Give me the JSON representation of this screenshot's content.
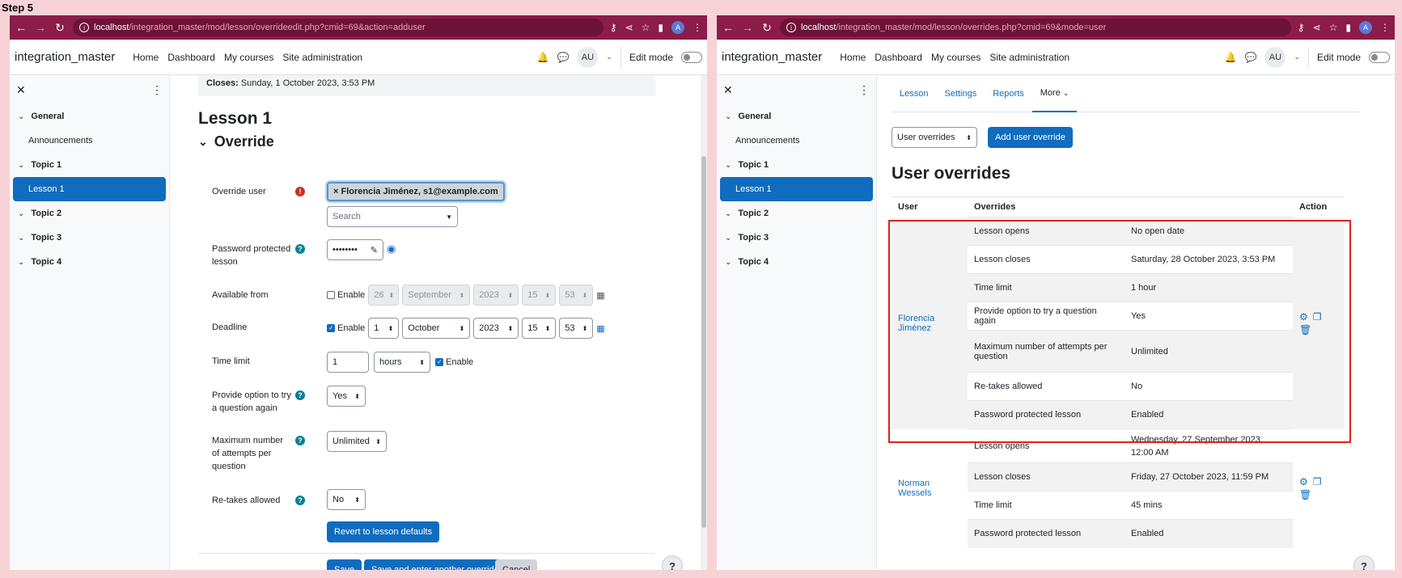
{
  "step_label": "Step 5",
  "left": {
    "url_host": "localhost",
    "url_path": "/integration_master/mod/lesson/overrideedit.php?cmid=69&action=adduser",
    "brand": "integration_master",
    "nav": [
      "Home",
      "Dashboard",
      "My courses",
      "Site administration"
    ],
    "avatar": "AU",
    "edit_mode": "Edit mode",
    "drawer": [
      {
        "label": "General",
        "type": "section"
      },
      {
        "label": "Announcements",
        "type": "sub"
      },
      {
        "label": "Topic 1",
        "type": "section"
      },
      {
        "label": "Lesson 1",
        "type": "active"
      },
      {
        "label": "Topic 2",
        "type": "section"
      },
      {
        "label": "Topic 3",
        "type": "section"
      },
      {
        "label": "Topic 4",
        "type": "section"
      }
    ],
    "closes_label": "Closes:",
    "closes_value": "Sunday, 1 October 2023, 3:53 PM",
    "page_title": "Lesson 1",
    "section_title": "Override",
    "form": {
      "override_user_label": "Override user",
      "override_user_chip": "× Florencia Jiménez, s1@example.com",
      "search_placeholder": "Search",
      "password_label": "Password protected lesson",
      "password_mask": "••••••••",
      "available_from_label": "Available from",
      "available_from": {
        "enable": "Enable",
        "day": "26",
        "month": "September",
        "year": "2023",
        "hour": "15",
        "minute": "53"
      },
      "deadline_label": "Deadline",
      "deadline": {
        "enable": "Enable",
        "day": "1",
        "month": "October",
        "year": "2023",
        "hour": "15",
        "minute": "53"
      },
      "time_limit_label": "Time limit",
      "time_limit_value": "1",
      "time_limit_unit": "hours",
      "time_limit_enable": "Enable",
      "try_again_label": "Provide option to try a question again",
      "try_again_value": "Yes",
      "max_attempts_label": "Maximum number of attempts per question",
      "max_attempts_value": "Unlimited",
      "retakes_label": "Re-takes allowed",
      "retakes_value": "No",
      "revert_button": "Revert to lesson defaults",
      "save_button": "Save",
      "save_another_button": "Save and enter another override",
      "cancel_button": "Cancel"
    }
  },
  "right": {
    "url_host": "localhost",
    "url_path": "/integration_master/mod/lesson/overrides.php?cmid=69&mode=user",
    "brand": "integration_master",
    "nav": [
      "Home",
      "Dashboard",
      "My courses",
      "Site administration"
    ],
    "avatar": "AU",
    "edit_mode": "Edit mode",
    "tabs": [
      "Lesson",
      "Settings",
      "Reports",
      "More"
    ],
    "overrides_select": "User overrides",
    "add_button": "Add user override",
    "page_title": "User overrides",
    "headers": {
      "user": "User",
      "overrides": "Overrides",
      "action": "Action"
    },
    "users": [
      {
        "name": "Florencia Jiménez",
        "rows": [
          [
            "Lesson opens",
            "No open date"
          ],
          [
            "Lesson closes",
            "Saturday, 28 October 2023, 3:53 PM"
          ],
          [
            "Time limit",
            "1 hour"
          ],
          [
            "Provide option to try a question again",
            "Yes"
          ],
          [
            "Maximum number of attempts per question",
            "Unlimited"
          ],
          [
            "Re-takes allowed",
            "No"
          ],
          [
            "Password protected lesson",
            "Enabled"
          ]
        ]
      },
      {
        "name": "Norman Wessels",
        "rows": [
          [
            "Lesson opens",
            "Wednesday, 27 September 2023, 12:00 AM"
          ],
          [
            "Lesson closes",
            "Friday, 27 October 2023, 11:59 PM"
          ],
          [
            "Time limit",
            "45 mins"
          ],
          [
            "Password protected lesson",
            "Enabled"
          ]
        ]
      }
    ]
  },
  "colors": {
    "browser_chrome": "#8c1c4a",
    "primary": "#0f6cbf",
    "highlight": "#e0201a"
  }
}
